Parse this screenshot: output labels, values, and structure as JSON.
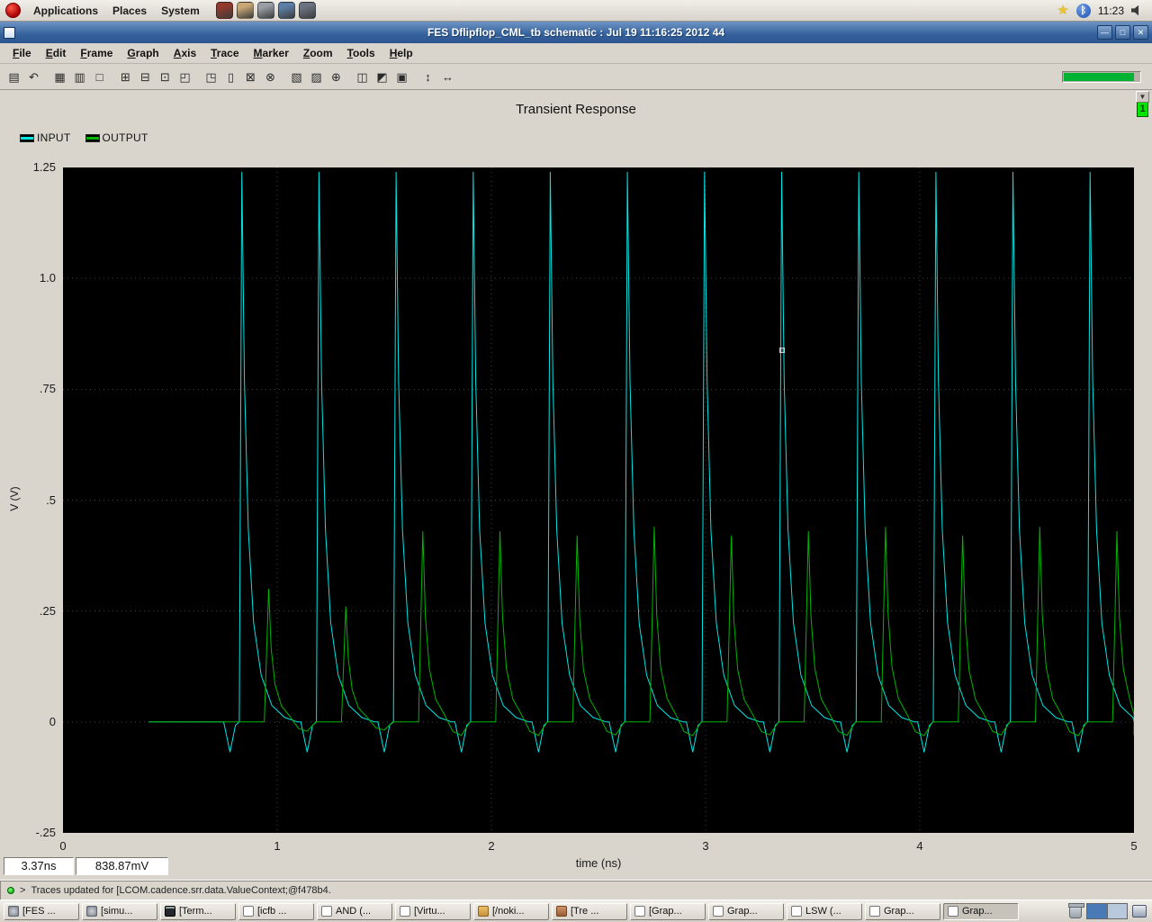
{
  "panel": {
    "menus": [
      "Applications",
      "Places",
      "System"
    ],
    "launchers": [
      {
        "name": "launcher-icon-1",
        "color": "#93392b"
      },
      {
        "name": "launcher-icon-2",
        "color": "#c9a876"
      },
      {
        "name": "launcher-icon-3",
        "color": "#9aa0a6"
      },
      {
        "name": "launcher-icon-4",
        "color": "#5b7fa6"
      },
      {
        "name": "launcher-icon-5",
        "color": "#6b7280"
      }
    ],
    "tray": {
      "star_glyph": "★",
      "bluetooth_glyph": "ᛒ",
      "clock": "11:23"
    }
  },
  "window": {
    "title": "FES Dflipflop_CML_tb schematic : Jul 19 11:16:25 2012 44",
    "controls": [
      {
        "name": "minimize-button",
        "glyph": "—"
      },
      {
        "name": "maximize-button",
        "glyph": "□"
      },
      {
        "name": "close-button",
        "glyph": "✕"
      }
    ],
    "menu": [
      "File",
      "Edit",
      "Frame",
      "Graph",
      "Axis",
      "Trace",
      "Marker",
      "Zoom",
      "Tools",
      "Help"
    ],
    "toolbar_icons": [
      {
        "name": "print-icon",
        "glyph": "▤"
      },
      {
        "name": "undo-icon",
        "glyph": "↶"
      },
      {
        "name": "grid-icon",
        "glyph": "▦"
      },
      {
        "name": "strip-chart-icon",
        "glyph": "▥"
      },
      {
        "name": "new-window-icon",
        "glyph": "□"
      },
      {
        "name": "split-horizontal-icon",
        "glyph": "⊞"
      },
      {
        "name": "split-vertical-icon",
        "glyph": "⊟"
      },
      {
        "name": "subplot-icon",
        "glyph": "⊡"
      },
      {
        "name": "layout-top-icon",
        "glyph": "◰"
      },
      {
        "name": "layout-right-icon",
        "glyph": "◳"
      },
      {
        "name": "single-strip-icon",
        "glyph": "▯"
      },
      {
        "name": "marker-icon",
        "glyph": "⊠"
      },
      {
        "name": "delete-marker-icon",
        "glyph": "⊗"
      },
      {
        "name": "vertical-marker-icon",
        "glyph": "▧"
      },
      {
        "name": "horizontal-marker-icon",
        "glyph": "▨"
      },
      {
        "name": "zoom-in-icon",
        "glyph": "⊕"
      },
      {
        "name": "zoom-x-icon",
        "glyph": "◫"
      },
      {
        "name": "zoom-y-icon",
        "glyph": "◩"
      },
      {
        "name": "zoom-fit-icon",
        "glyph": "▣"
      },
      {
        "name": "pan-vertical-icon",
        "glyph": "↕"
      },
      {
        "name": "pan-horizontal-icon",
        "glyph": "↔"
      }
    ],
    "progress": {
      "percent": 93,
      "color": "#00b332"
    },
    "header_badge": "1",
    "dropdown_glyph": "▼",
    "status": {
      "cursor_x": "3.37ns",
      "cursor_y": "838.87mV",
      "prompt": ">",
      "message": "Traces updated for [LCOM.cadence.srr.data.ValueContext;@f478b4."
    }
  },
  "taskbar": {
    "buttons": [
      {
        "label": "[FES ...",
        "icon": "gear"
      },
      {
        "label": "[simu...",
        "icon": "gear"
      },
      {
        "label": "[Term...",
        "icon": "terminal"
      },
      {
        "label": "[icfb ...",
        "icon": "page"
      },
      {
        "label": "AND (...",
        "icon": "page"
      },
      {
        "label": "[Virtu...",
        "icon": "page"
      },
      {
        "label": "[/noki...",
        "icon": "folder"
      },
      {
        "label": "[Tre ...",
        "icon": "clay"
      },
      {
        "label": "[Grap...",
        "icon": "page"
      },
      {
        "label": "Grap...",
        "icon": "page"
      },
      {
        "label": "LSW (...",
        "icon": "page"
      },
      {
        "label": "Grap...",
        "icon": "page"
      },
      {
        "label": "Grap...",
        "icon": "page",
        "active": true
      }
    ]
  },
  "chart_data": {
    "type": "line",
    "title": "Transient Response",
    "xlabel": "time (ns)",
    "ylabel": "V (V)",
    "xlim": [
      0,
      5
    ],
    "ylim": [
      -0.25,
      1.25
    ],
    "grid": "dotted",
    "legend_position": "top-left",
    "x_ticks": [
      {
        "v": 0,
        "label": "0"
      },
      {
        "v": 1,
        "label": "1"
      },
      {
        "v": 2,
        "label": "2"
      },
      {
        "v": 3,
        "label": "3"
      },
      {
        "v": 4,
        "label": "4"
      },
      {
        "v": 5,
        "label": "5"
      }
    ],
    "y_ticks": [
      {
        "v": 1.25,
        "label": "1.25"
      },
      {
        "v": 1.0,
        "label": "1.0"
      },
      {
        "v": 0.75,
        "label": ".75"
      },
      {
        "v": 0.5,
        "label": ".5"
      },
      {
        "v": 0.25,
        "label": ".25"
      },
      {
        "v": 0,
        "label": "0"
      },
      {
        "v": -0.25,
        "label": "-.25"
      }
    ],
    "series": [
      {
        "name": "INPUT",
        "color": "#00e6e6",
        "baseline": 0,
        "trace_start": 0.4,
        "pulse_shape": [
          [
            -0.085,
            0
          ],
          [
            -0.055,
            -0.055
          ],
          [
            -0.03,
            -0.006
          ],
          [
            -0.012,
            0
          ],
          [
            0,
            1
          ],
          [
            0.012,
            0.62
          ],
          [
            0.03,
            0.35
          ],
          [
            0.055,
            0.18
          ],
          [
            0.09,
            0.085
          ],
          [
            0.14,
            0.03
          ],
          [
            0.2,
            0.008
          ],
          [
            0.26,
            0
          ]
        ],
        "pulses": [
          {
            "t": 0.835,
            "peak": 1.24
          },
          {
            "t": 1.195,
            "peak": 1.24
          },
          {
            "t": 1.555,
            "peak": 1.24
          },
          {
            "t": 1.915,
            "peak": 1.24
          },
          {
            "t": 2.275,
            "peak": 1.24
          },
          {
            "t": 2.635,
            "peak": 1.24
          },
          {
            "t": 2.995,
            "peak": 1.24
          },
          {
            "t": 3.355,
            "peak": 1.24
          },
          {
            "t": 3.715,
            "peak": 1.24
          },
          {
            "t": 4.075,
            "peak": 1.24
          },
          {
            "t": 4.435,
            "peak": 1.24
          },
          {
            "t": 4.795,
            "peak": 1.24
          }
        ]
      },
      {
        "name": "OUTPUT",
        "color": "#00b400",
        "baseline": 0,
        "trace_start": 0.4,
        "pulse_shape": [
          [
            -0.02,
            0
          ],
          [
            0,
            1
          ],
          [
            0.012,
            0.55
          ],
          [
            0.03,
            0.28
          ],
          [
            0.06,
            0.12
          ],
          [
            0.1,
            0.04
          ],
          [
            0.14,
            -0.05
          ],
          [
            0.18,
            -0.07
          ],
          [
            0.22,
            0
          ]
        ],
        "pulses": [
          {
            "t": 0.96,
            "peak": 0.3
          },
          {
            "t": 1.32,
            "peak": 0.26
          },
          {
            "t": 1.68,
            "peak": 0.43
          },
          {
            "t": 2.04,
            "peak": 0.43
          },
          {
            "t": 2.4,
            "peak": 0.42
          },
          {
            "t": 2.76,
            "peak": 0.44
          },
          {
            "t": 3.12,
            "peak": 0.42
          },
          {
            "t": 3.48,
            "peak": 0.43
          },
          {
            "t": 3.84,
            "peak": 0.44
          },
          {
            "t": 4.2,
            "peak": 0.42
          },
          {
            "t": 4.56,
            "peak": 0.44
          },
          {
            "t": 4.92,
            "peak": 0.43
          }
        ]
      }
    ]
  }
}
